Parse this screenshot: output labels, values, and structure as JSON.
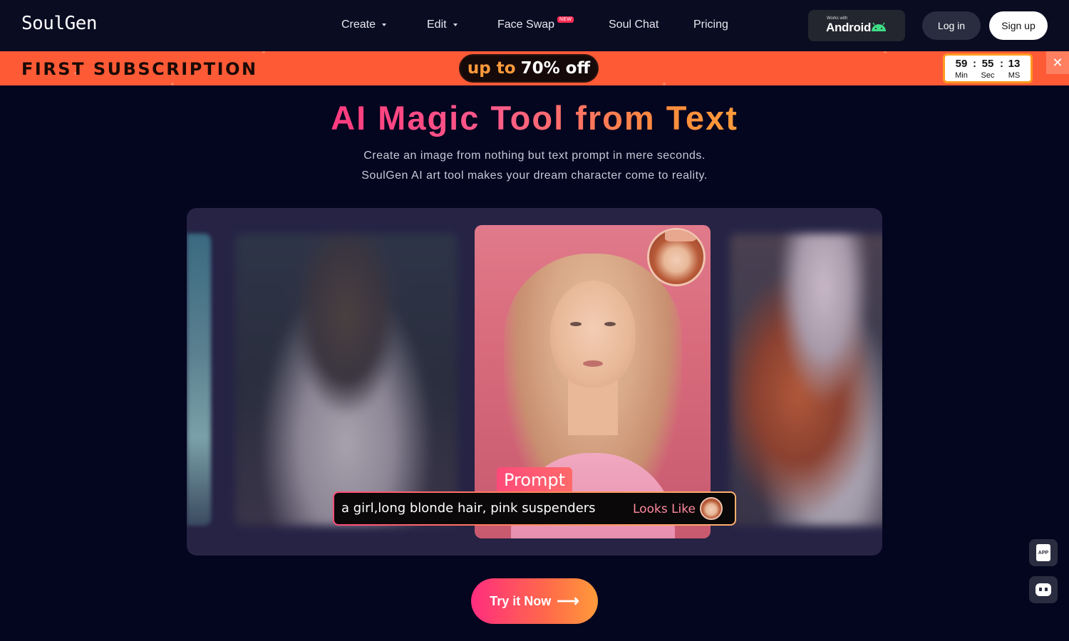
{
  "nav": {
    "logo": "SoulGen",
    "items": [
      {
        "label": "Create",
        "has_dropdown": true
      },
      {
        "label": "Edit",
        "has_dropdown": true
      },
      {
        "label": "Face Swap",
        "badge": "NEW"
      },
      {
        "label": "Soul Chat"
      },
      {
        "label": "Pricing"
      }
    ],
    "android": {
      "works_with": "Works with",
      "label": "Android",
      "icon": "android-robot-icon"
    },
    "login_label": "Log in",
    "signup_label": "Sign up"
  },
  "promo": {
    "title": "FIRST SUBSCRIPTION",
    "up_to": "up to",
    "discount": "70% off",
    "timer": {
      "min": "59",
      "sec": "55",
      "ms": "13",
      "min_label": "Min",
      "sec_label": "Sec",
      "ms_label": "MS",
      "sep": ":"
    },
    "close_icon": "close-icon",
    "close_glyph": "✕"
  },
  "hero": {
    "title": "AI Magic Tool from Text",
    "subtitle_line1": "Create an image from nothing but text prompt in mere seconds.",
    "subtitle_line2": "SoulGen AI art tool makes your dream character come to reality."
  },
  "prompt": {
    "tag": "Prompt",
    "text": "a girl,long blonde hair, pink suspenders",
    "looks_like": "Looks Like"
  },
  "cta": {
    "label": "Try it Now",
    "arrow": "⟶"
  },
  "floating": {
    "app_label": "APP",
    "app_icon": "app-download-icon",
    "chat_icon": "chat-bot-icon"
  },
  "colors": {
    "background": "#04051f",
    "nav_bg": "#0a0c22",
    "promo_bg": "#ff5a36",
    "accent_pink": "#ff3b7f",
    "accent_orange": "#ff9a3a",
    "gallery_bg": "#262345"
  }
}
